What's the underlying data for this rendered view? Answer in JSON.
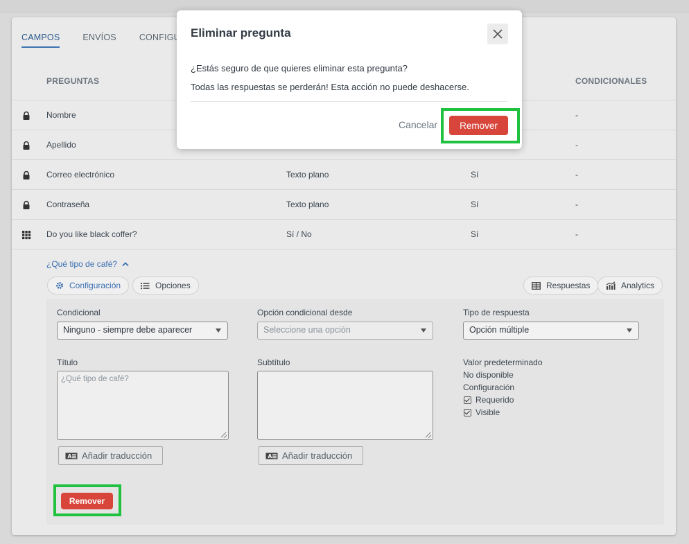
{
  "tabs": [
    "CAMPOS",
    "ENVÍOS",
    "CONFIGURA"
  ],
  "table": {
    "headers": {
      "preguntas": "PREGUNTAS",
      "condicionales": "CONDICIONALES"
    },
    "rows": [
      {
        "icon": "lock-icon",
        "pregunta": "Nombre",
        "tipo": "",
        "requerido": "",
        "condicional": "-"
      },
      {
        "icon": "lock-icon",
        "pregunta": "Apellido",
        "tipo": "",
        "requerido": "",
        "condicional": "-"
      },
      {
        "icon": "lock-icon",
        "pregunta": "Correo electrónico",
        "tipo": "Texto plano",
        "requerido": "Sí",
        "condicional": "-"
      },
      {
        "icon": "lock-icon",
        "pregunta": "Contraseña",
        "tipo": "Texto plano",
        "requerido": "Sí",
        "condicional": "-"
      },
      {
        "icon": "grid-icon",
        "pregunta": "Do you like black coffer?",
        "tipo": "Sí / No",
        "requerido": "Sí",
        "condicional": "-"
      }
    ]
  },
  "expanded": {
    "question_link": "¿Qué tipo de café?",
    "pills": {
      "configuracion": "Configuración",
      "opciones": "Opciones",
      "respuestas": "Respuestas",
      "analytics": "Analytics"
    },
    "form": {
      "condicional_label": "Condicional",
      "condicional_value": "Ninguno - siempre debe aparecer",
      "opcion_label": "Opción condicional desde",
      "opcion_placeholder": "Seleccione una opción",
      "tipo_label": "Tipo de respuesta",
      "tipo_value": "Opción múltiple",
      "titulo_label": "Título",
      "titulo_placeholder": "¿Qué tipo de café?",
      "subtitulo_label": "Subtítulo",
      "valor_label": "Valor predeterminado",
      "valor_value": "No disponible",
      "config_label": "Configuración",
      "requerido": "Requerido",
      "visible": "Visible",
      "translate_button": "Añadir traducción",
      "remove_button": "Remover"
    }
  },
  "modal": {
    "title": "Eliminar pregunta",
    "line1": "¿Estás seguro de que quieres eliminar esta pregunta?",
    "line2": "Todas las respuestas se perderán! Esta acción no puede deshacerse.",
    "cancel": "Cancelar",
    "remove": "Remover"
  },
  "colors": {
    "accent": "#3b73b1",
    "danger": "#d8453b",
    "highlight": "#20c13e"
  }
}
